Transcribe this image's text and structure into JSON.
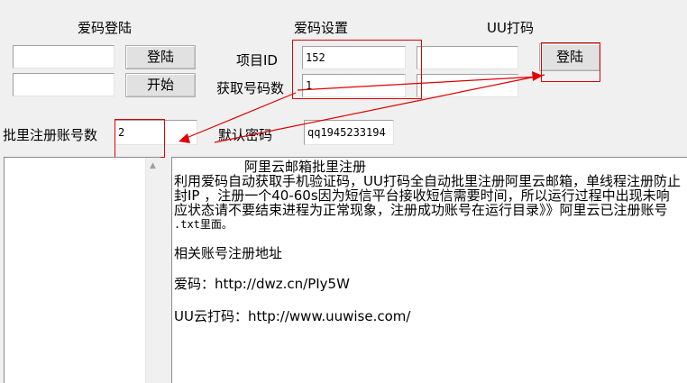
{
  "sections": {
    "aima_login": "爱码登陆",
    "aima_settings": "爱码设置",
    "uu_captcha": "UU打码"
  },
  "aima_login": {
    "username_value": "",
    "password_value": "",
    "login_button": "登陆",
    "start_button": "开始"
  },
  "aima_settings": {
    "project_id_label": "项目ID",
    "project_id_value": "152",
    "get_count_label": "获取号码数",
    "get_count_value": "1"
  },
  "uu": {
    "username_value": "",
    "password_value": "",
    "login_button": "登陆"
  },
  "batch": {
    "count_label": "批里注册账号数",
    "count_value": "2",
    "default_password_label": "默认密码",
    "default_password_value": "qq1945233194"
  },
  "log": {
    "lines": [
      "阿里云邮箱批里注册",
      "利用爱码自动获取手机验证码，UU打码全自动批里注册阿里云邮箱，单线程注册防止",
      "封IP ，注册一个40-60s因为短信平台接收短信需要时间，所以运行过程中出现未响",
      "应状态请不要结束进程为正常现象，注册成功账号在运行目录》》阿里云已注册账号",
      ".txt里面。",
      "",
      "相关账号注册地址",
      "",
      "爱码：http://dwz.cn/PIy5W",
      "",
      "UU云打码：http://www.uuwise.com/"
    ]
  },
  "colors": {
    "annotation_red": "#e00000"
  }
}
